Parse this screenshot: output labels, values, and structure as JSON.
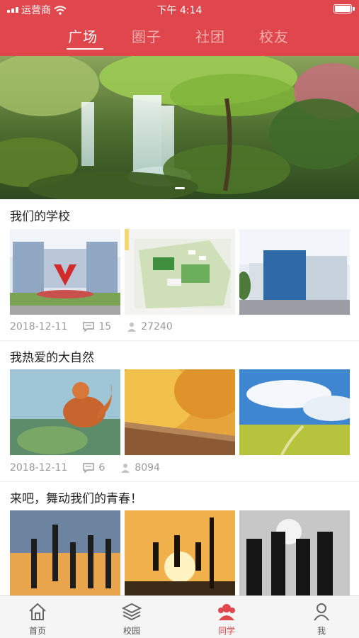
{
  "status_bar": {
    "carrier": "运营商",
    "time": "下午 4:14"
  },
  "top_tabs": [
    {
      "label": "广场",
      "active": true
    },
    {
      "label": "圈子",
      "active": false
    },
    {
      "label": "社团",
      "active": false
    },
    {
      "label": "校友",
      "active": false
    }
  ],
  "posts": [
    {
      "title": "我们的学校",
      "date": "2018-12-11",
      "comments": "15",
      "views": "27240"
    },
    {
      "title": "我热爱的大自然",
      "date": "2018-12-11",
      "comments": "6",
      "views": "8094"
    },
    {
      "title": "来吧，舞动我们的青春！"
    }
  ],
  "bottom_nav": [
    {
      "label": "首页",
      "icon": "home-icon",
      "active": false
    },
    {
      "label": "校园",
      "icon": "layers-icon",
      "active": false
    },
    {
      "label": "同学",
      "icon": "classmates-icon",
      "active": true
    },
    {
      "label": "我",
      "icon": "person-icon",
      "active": false
    }
  ],
  "colors": {
    "accent": "#e0474c",
    "meta_text": "#9a9a9a"
  }
}
